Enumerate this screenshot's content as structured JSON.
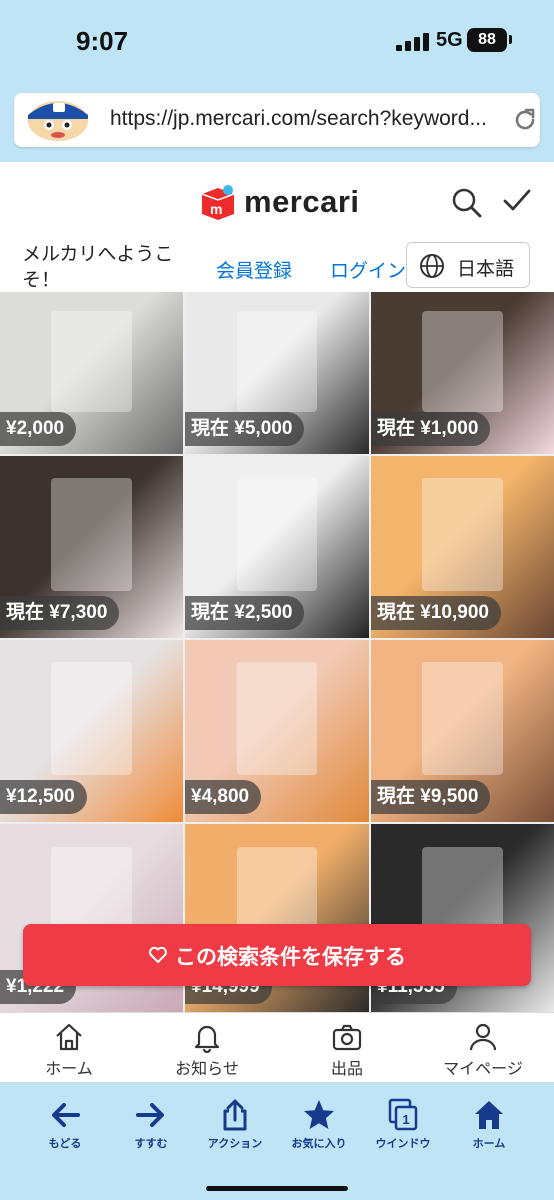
{
  "status": {
    "time": "9:07",
    "network": "5G",
    "battery": "88"
  },
  "browser": {
    "url": "https://jp.mercari.com/search?keyword..."
  },
  "header": {
    "brand": "mercari"
  },
  "welcome": {
    "text": "メルカリへようこそ！",
    "signup": "会員登録",
    "login": "ログイン",
    "language": "日本語"
  },
  "items": [
    {
      "price": "¥2,000",
      "colors": [
        "#dcdcd8",
        "#6b6b6b"
      ]
    },
    {
      "price": "現在 ¥5,000",
      "colors": [
        "#e9e9e9",
        "#2a2a2a"
      ]
    },
    {
      "price": "現在 ¥1,000",
      "colors": [
        "#4a3b33",
        "#f4d9e1"
      ]
    },
    {
      "price": "現在 ¥7,300",
      "colors": [
        "#3d332e",
        "#f1e6e6"
      ]
    },
    {
      "price": "現在 ¥2,500",
      "colors": [
        "#efefef",
        "#222222"
      ]
    },
    {
      "price": "現在 ¥10,900",
      "colors": [
        "#f3b46b",
        "#6a4733"
      ]
    },
    {
      "price": "¥12,500",
      "colors": [
        "#e6e2e4",
        "#f08c3a"
      ]
    },
    {
      "price": "¥4,800",
      "colors": [
        "#f1c9b4",
        "#e08a3c"
      ]
    },
    {
      "price": "現在 ¥9,500",
      "colors": [
        "#f2b482",
        "#7a5038"
      ]
    },
    {
      "price": "¥1,222",
      "colors": [
        "#e6dde0",
        "#c9a8b6"
      ]
    },
    {
      "price": "¥14,999",
      "colors": [
        "#f0ae6a",
        "#2b2b2b"
      ]
    },
    {
      "price": "¥11,555",
      "colors": [
        "#2a2a2a",
        "#e9e9e9"
      ]
    }
  ],
  "save_button": {
    "label": "この検索条件を保存する"
  },
  "tabs": [
    {
      "label": "ホーム",
      "icon": "house-icon"
    },
    {
      "label": "お知らせ",
      "icon": "bell-icon"
    },
    {
      "label": "出品",
      "icon": "camera-icon"
    },
    {
      "label": "マイページ",
      "icon": "person-icon"
    }
  ],
  "toolbar": [
    {
      "label": "もどる",
      "icon": "back-arrow-icon"
    },
    {
      "label": "すすむ",
      "icon": "forward-arrow-icon"
    },
    {
      "label": "アクション",
      "icon": "share-icon"
    },
    {
      "label": "お気に入り",
      "icon": "star-icon"
    },
    {
      "label": "ウインドウ",
      "icon": "windows-icon"
    },
    {
      "label": "ホーム",
      "icon": "home-icon"
    }
  ],
  "toolbar_window_count": "1",
  "colors": {
    "accent": "#ee3b45",
    "link": "#0074d9",
    "chrome": "#bfe4f6",
    "toolbar_icon": "#173a8c"
  }
}
